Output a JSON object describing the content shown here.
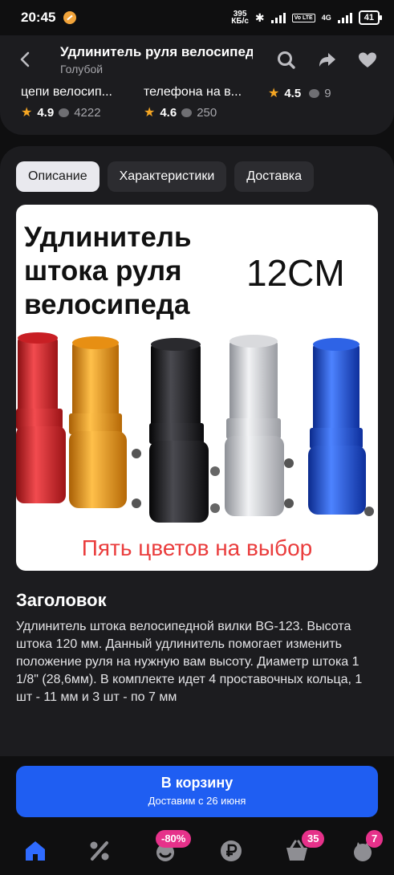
{
  "status_bar": {
    "time": "20:45",
    "speed_value": "395",
    "speed_unit": "КБ/с",
    "network_type": "4G",
    "volte": "Vo LTE",
    "battery": "41"
  },
  "header": {
    "title": "Удлинитель руля велосипед",
    "subtitle": "Голубой",
    "icons": [
      "back-arrow-icon",
      "search-icon",
      "share-icon",
      "heart-icon"
    ]
  },
  "related": [
    {
      "name": "цепи велосип...",
      "rating": "4.9",
      "reviews": "4222"
    },
    {
      "name": "телефона на в...",
      "rating": "4.6",
      "reviews": "250"
    },
    {
      "name": "",
      "rating": "4.5",
      "reviews": "9"
    }
  ],
  "tabs": [
    {
      "label": "Описание",
      "active": true
    },
    {
      "label": "Характеристики",
      "active": false
    },
    {
      "label": "Доставка",
      "active": false
    }
  ],
  "promo": {
    "title_lines": [
      "Удлинитель",
      "штока руля",
      "велосипеда"
    ],
    "size": "12CM",
    "footer": "Пять цветов на выбор",
    "product_colors": [
      "#e0262b",
      "#f39a1b",
      "#1b1b1d",
      "#c9cbd0",
      "#1d54d8"
    ]
  },
  "description": {
    "heading": "Заголовок",
    "text": "Удлинитель штока велосипедной вилки BG-123. Высота штока 120 мм. Данный удлинитель помогает изменить положение руля на нужную вам высоту. Диаметр штока 1 1/8\" (28,6мм). В комплекте идет 4 проставочных кольца, 1 шт - 11 мм и 3 шт - по 7 мм"
  },
  "cart": {
    "label": "В корзину",
    "delivery": "Доставим с 26 июня"
  },
  "bottom_nav": {
    "items": [
      {
        "icon": "home-icon",
        "badge": ""
      },
      {
        "icon": "percent-icon",
        "badge": ""
      },
      {
        "icon": "promo-icon",
        "badge": "-80%"
      },
      {
        "icon": "ruble-icon",
        "badge": ""
      },
      {
        "icon": "basket-icon",
        "badge": "35"
      },
      {
        "icon": "profile-icon",
        "badge": "7"
      }
    ]
  },
  "colors": {
    "accent": "#1f5ef2",
    "badge": "#e6318a",
    "star": "#f5a623",
    "background": "#0f0f10",
    "card": "#1c1c1f"
  }
}
